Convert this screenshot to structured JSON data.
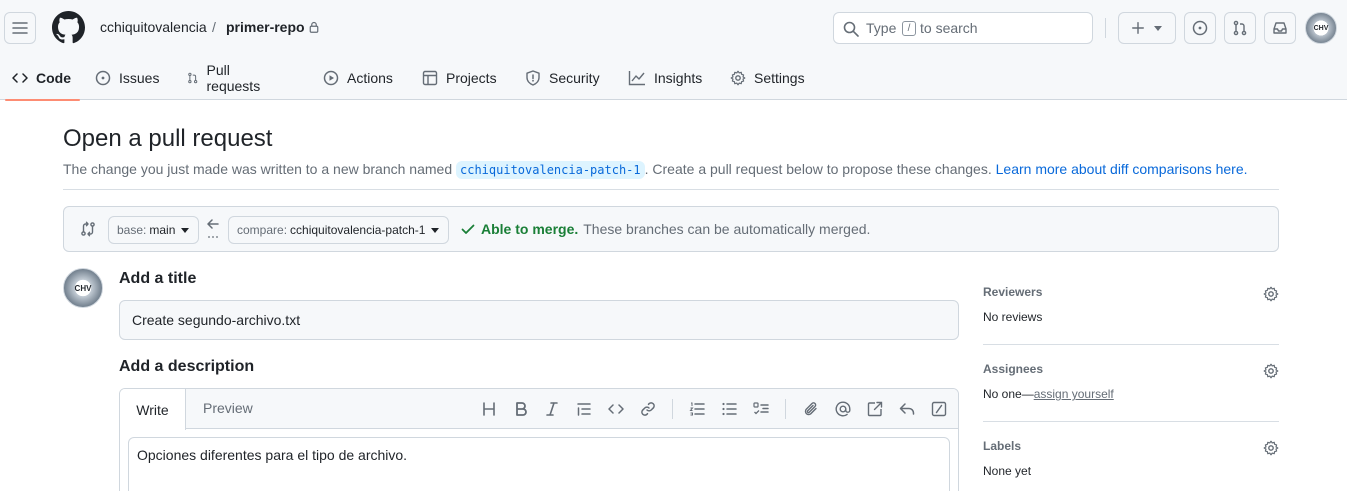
{
  "header": {
    "owner": "cchiquitovalencia",
    "separator": "/",
    "repo": "primer-repo",
    "search": {
      "before": "Type",
      "key": "/",
      "after": "to search"
    },
    "avatar_text": "CHV"
  },
  "nav": {
    "items": [
      {
        "label": "Code",
        "icon": "code-icon"
      },
      {
        "label": "Issues",
        "icon": "issue-opened-icon"
      },
      {
        "label": "Pull requests",
        "icon": "git-pull-request-icon"
      },
      {
        "label": "Actions",
        "icon": "play-icon"
      },
      {
        "label": "Projects",
        "icon": "table-icon"
      },
      {
        "label": "Security",
        "icon": "shield-icon"
      },
      {
        "label": "Insights",
        "icon": "graph-icon"
      },
      {
        "label": "Settings",
        "icon": "gear-icon"
      }
    ],
    "selected": "Code"
  },
  "page": {
    "title": "Open a pull request",
    "subtitle_before": "The change you just made was written to a new branch named ",
    "branch_name": "cchiquitovalencia-patch-1",
    "subtitle_after": ". Create a pull request below to propose these changes. ",
    "learn_more": "Learn more about diff comparisons here."
  },
  "compare": {
    "base_label": "base:",
    "base_value": "main",
    "compare_label": "compare:",
    "compare_value": "cchiquitovalencia-patch-1",
    "merge_status": "Able to merge.",
    "merge_detail": "These branches can be automatically merged."
  },
  "form": {
    "avatar_text": "CHV",
    "title_heading": "Add a title",
    "title_value": "Create segundo-archivo.txt",
    "desc_heading": "Add a description",
    "tab_write": "Write",
    "tab_preview": "Preview",
    "description_value": "Opciones diferentes para el tipo de archivo."
  },
  "sidebar": {
    "reviewers": {
      "heading": "Reviewers",
      "value": "No reviews"
    },
    "assignees": {
      "heading": "Assignees",
      "value_before": "No one—",
      "assign_link": "assign yourself"
    },
    "labels": {
      "heading": "Labels",
      "value": "None yet"
    }
  },
  "colors": {
    "accent_link": "#0969da",
    "success": "#1a7f37",
    "selected_underline": "#fd8c73",
    "border": "#d0d7de"
  }
}
